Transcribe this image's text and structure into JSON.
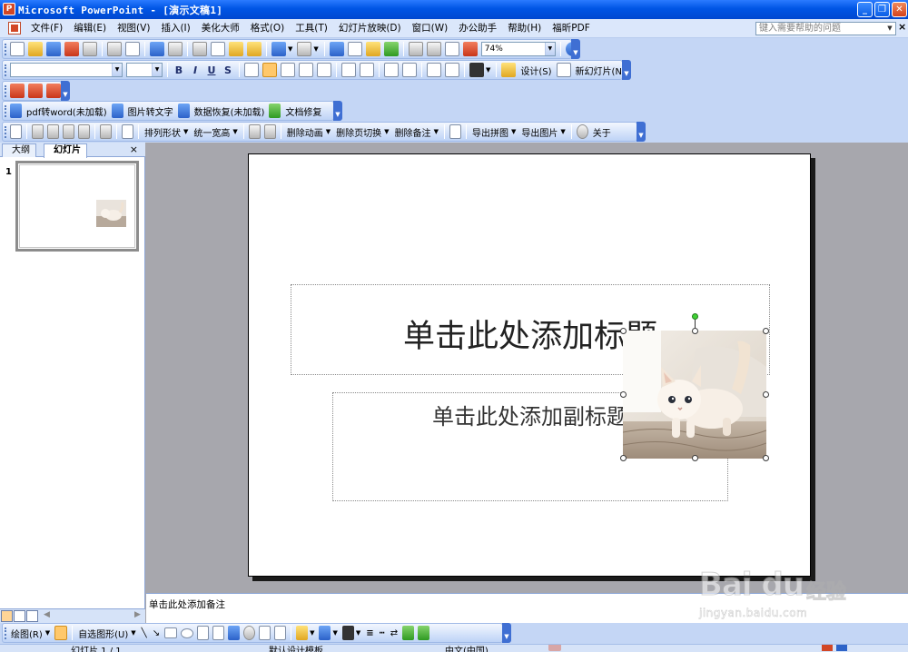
{
  "window": {
    "title": "Microsoft PowerPoint - [演示文稿1]",
    "app_icon": "powerpoint-icon"
  },
  "menu": {
    "items": [
      "文件(F)",
      "编辑(E)",
      "视图(V)",
      "插入(I)",
      "美化大师",
      "格式(O)",
      "工具(T)",
      "幻灯片放映(D)",
      "窗口(W)",
      "办公助手",
      "帮助(H)",
      "福昕PDF"
    ],
    "help_placeholder": "键入需要帮助的问题",
    "close_glyph": "×"
  },
  "standard_toolbar": {
    "zoom": "74%"
  },
  "formatting_toolbar": {
    "font_name": "",
    "font_size": "",
    "bold": "B",
    "italic": "I",
    "underline": "U",
    "shadow": "S",
    "design_label": "设计(S)",
    "new_slide_label": "新幻灯片(N)"
  },
  "addin_toolbar": {
    "items": [
      "pdf转word(未加载)",
      "图片转文字",
      "数据恢复(未加载)",
      "文档修复"
    ]
  },
  "beautify_toolbar": {
    "items": [
      "排列形状",
      "统一宽高",
      "删除动画",
      "删除页切换",
      "删除备注",
      "导出拼图",
      "导出图片",
      "关于"
    ]
  },
  "outline_pane": {
    "tabs": [
      "大纲",
      "幻灯片"
    ],
    "active_tab": "幻灯片",
    "close_glyph": "×",
    "slide_number": "1"
  },
  "slide": {
    "title_placeholder": "单击此处添加标题",
    "subtitle_placeholder": "单击此处添加副标题"
  },
  "notes": {
    "placeholder": "单击此处添加备注"
  },
  "drawing_toolbar": {
    "draw_label": "绘图(R)",
    "autoshape_label": "自选图形(U)"
  },
  "statusbar": {
    "slide_info": "幻灯片 1 / 1",
    "design_template": "默认设计模板",
    "language": "中文(中国)"
  },
  "watermark": {
    "main": "Bai du",
    "cn": "经验",
    "url": "jingyan.baidu.com"
  },
  "colors": {
    "titlebar": "#0055e5",
    "toolbar": "#c4d6f5",
    "workspace": "#a7a7ad",
    "selection_handle_rotate": "#3fd134"
  }
}
